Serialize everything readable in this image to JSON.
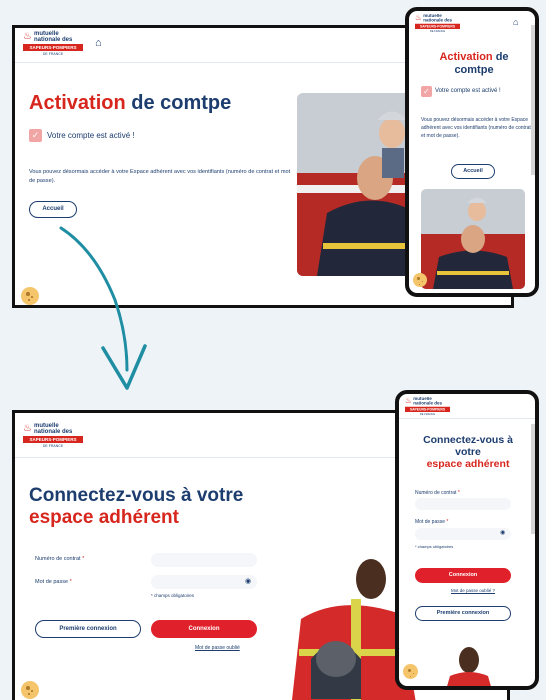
{
  "brand": {
    "line1": "mutuelle",
    "line2": "nationale des",
    "band": "SAPEURS-POMPIERS",
    "sub": "DE FRANCE"
  },
  "activation": {
    "title_red": "Activation",
    "title_navy": "de comtpe",
    "success": "Votre compte est activé !",
    "info": "Vous pouvez désormais accéder à votre Espace adhérent avec vos identifiants (numéro de contrat et mot de passe).",
    "button": "Accueil"
  },
  "login": {
    "title_navy": "Connectez-vous à votre",
    "title_red": "espace adhérent",
    "contract_label": "Numéro de contrat",
    "password_label": "Mot de passe",
    "required_star": "*",
    "required_note": "* champs obligatoires",
    "first_login": "Première connexion",
    "connect": "Connexion",
    "forgot": "Mot de passe oublié"
  },
  "mobile_login": {
    "title_line1": "Connectez-vous à",
    "title_line2": "votre",
    "title_line3": "espace adhérent",
    "forgot": "Mot de passe oublié ?"
  },
  "colors": {
    "navy": "#1c3d6e",
    "red": "#d7261e",
    "background": "#eef3f8",
    "arrow": "#1f8ea3"
  },
  "icons": [
    "home-icon",
    "check-icon",
    "eye-icon",
    "cookie-icon",
    "flame-icon"
  ]
}
